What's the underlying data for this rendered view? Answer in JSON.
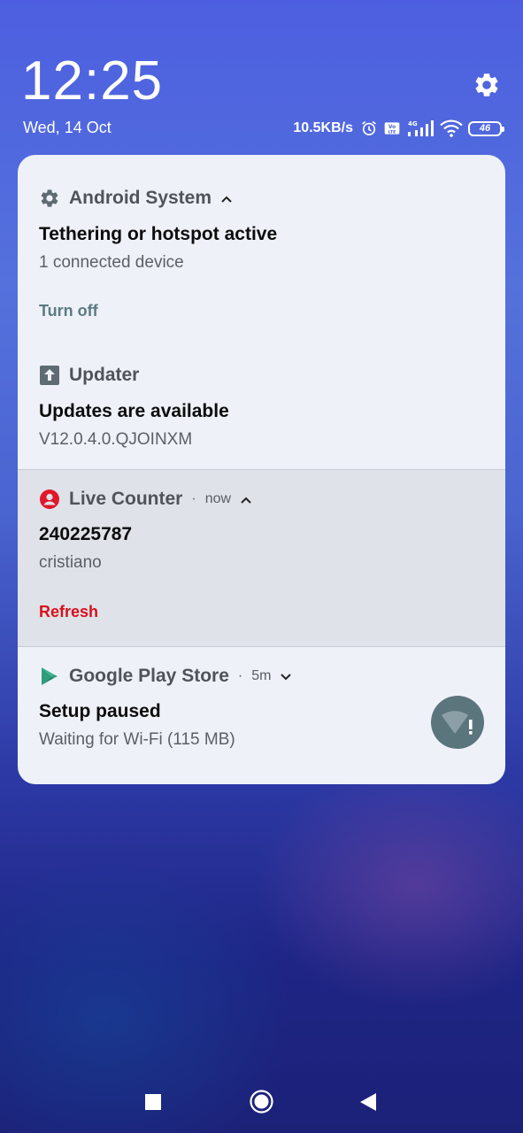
{
  "lockscreen": {
    "time": "12:25",
    "date": "Wed, 14 Oct"
  },
  "status": {
    "net_speed": "10.5KB/s",
    "battery": "46",
    "icons": [
      "alarm-icon",
      "volte-icon",
      "4g-signal-icon",
      "wifi-icon",
      "battery-icon"
    ]
  },
  "notifications": [
    {
      "app": "Android System",
      "icon": "gear-icon",
      "time": "",
      "title": "Tethering or hotspot active",
      "text": "1 connected device",
      "action": "Turn off",
      "action_color": "#5c7a80"
    },
    {
      "app": "Updater",
      "icon": "upload-arrow-icon",
      "time": "",
      "title": "Updates are available",
      "text": "V12.0.4.0.QJOINXM",
      "action": ""
    },
    {
      "app": "Live Counter",
      "icon": "account-icon",
      "icon_color": "#e0182b",
      "time": "now",
      "title": "240225787",
      "text": "cristiano",
      "action": "Refresh",
      "action_color": "#d7111b"
    },
    {
      "app": "Google Play Store",
      "icon": "play-store-icon",
      "time": "5m",
      "title": "Setup paused",
      "text": "Waiting for Wi-Fi (115 MB)",
      "badge_icon": "wifi-alert-icon"
    }
  ],
  "colors": {
    "panel_bg": "#eef1f8",
    "highlight_bg": "#e0e2e9",
    "accent_teal": "#5c7a80",
    "accent_red": "#d7111b"
  },
  "navigation": [
    "recents-button",
    "home-button",
    "back-button"
  ]
}
